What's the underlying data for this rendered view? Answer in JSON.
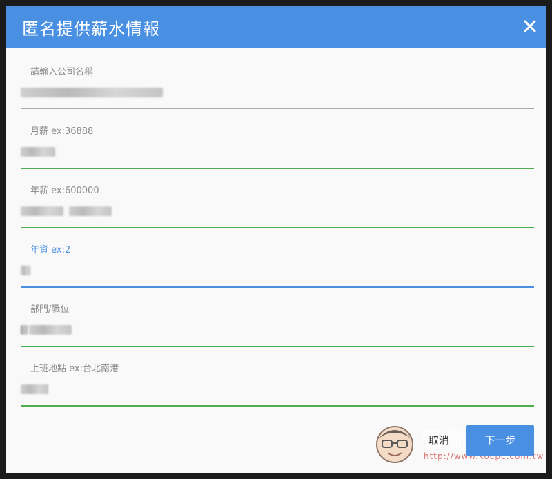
{
  "dialog": {
    "title": "匿名提供薪水情報",
    "close_icon": "close-icon"
  },
  "fields": [
    {
      "label": "請輸入公司名稱",
      "state": "default"
    },
    {
      "label": "月薪 ex:36888",
      "state": "valid"
    },
    {
      "label": "年薪 ex:600000",
      "state": "valid"
    },
    {
      "label": "年資 ex:2",
      "state": "focused"
    },
    {
      "label": "部門/職位",
      "state": "valid"
    },
    {
      "label": "上班地點 ex:台北南港",
      "state": "valid"
    }
  ],
  "buttons": {
    "cancel": "取消",
    "next": "下一步"
  },
  "watermark": {
    "text": "電腦王阿達",
    "url": "http://www.kocpc.com.tw"
  },
  "colors": {
    "header": "#4a90e2",
    "valid_underline": "#4caf50",
    "focus_underline": "#4a90e2",
    "default_underline": "#a9a9a9"
  }
}
